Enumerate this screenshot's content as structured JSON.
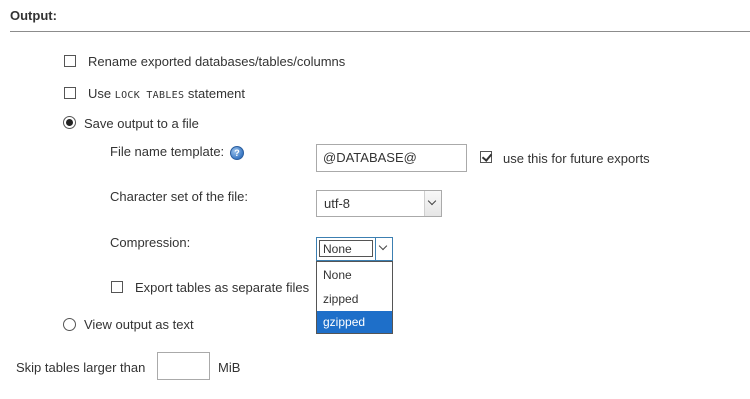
{
  "section": {
    "title": "Output:"
  },
  "options": {
    "rename": {
      "label": "Rename exported databases/tables/columns",
      "checked": false
    },
    "lock_tables": {
      "prefix": "Use",
      "code": "LOCK TABLES",
      "suffix": "statement",
      "checked": false
    },
    "save_to_file": {
      "label": "Save output to a file",
      "selected": true
    },
    "view_as_text": {
      "label": "View output as text",
      "selected": false
    }
  },
  "file": {
    "template_label": "File name template:",
    "help_icon": "question-icon",
    "template_value": "@DATABASE@",
    "remember_label": "use this for future exports",
    "remember_checked": true,
    "charset_label": "Character set of the file:",
    "charset_value": "utf-8",
    "compression_label": "Compression:",
    "compression_value": "None",
    "compression_options": [
      "None",
      "zipped",
      "gzipped"
    ],
    "compression_highlighted": "gzipped",
    "separate_files_label": "Export tables as separate files",
    "separate_files_checked": false
  },
  "skip": {
    "label": "Skip tables larger than",
    "value": "",
    "unit": "MiB"
  },
  "colors": {
    "highlight": "#1e6fc9",
    "focus_border": "#3c7fb1",
    "help_icon": "#3a78c4"
  }
}
